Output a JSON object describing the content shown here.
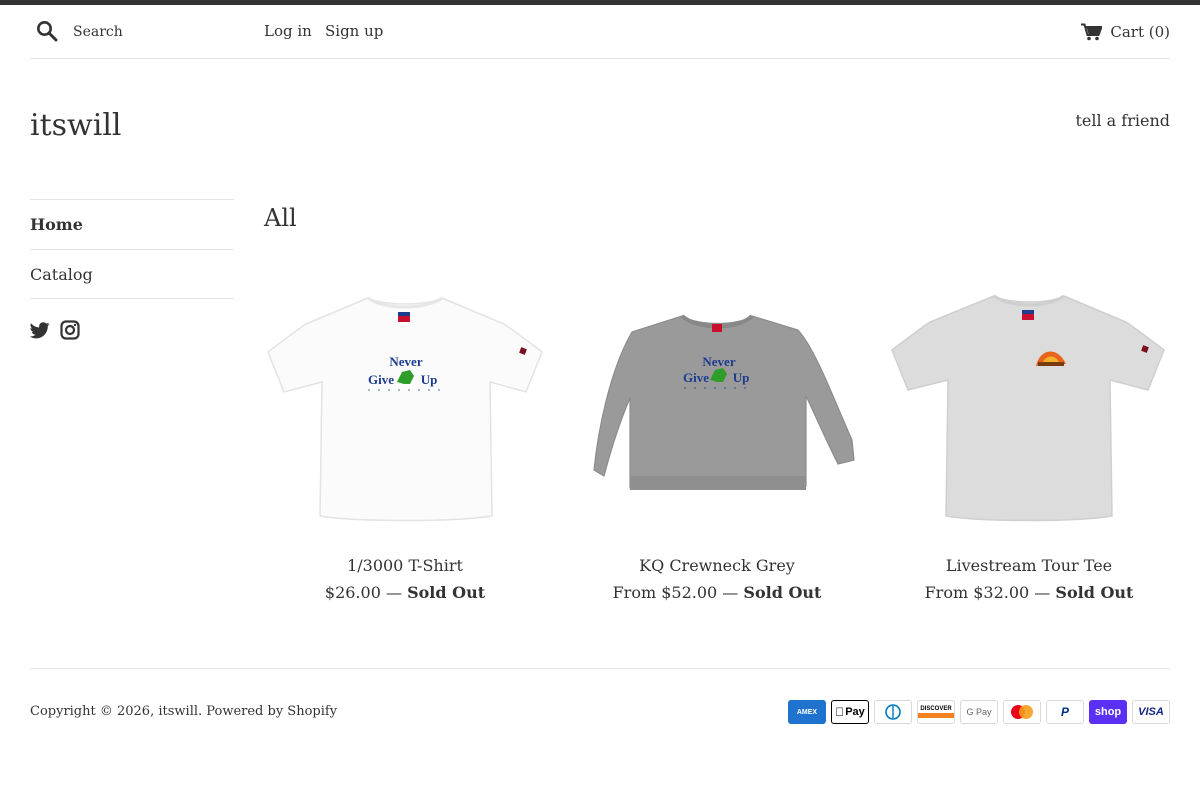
{
  "header": {
    "search_placeholder": "Search",
    "login_label": "Log in",
    "signup_label": "Sign up",
    "cart_label": "Cart (0)"
  },
  "site": {
    "title": "itswill",
    "tell_a_friend": "tell a friend"
  },
  "sidenav": {
    "items": [
      {
        "label": "Home",
        "active": true
      },
      {
        "label": "Catalog",
        "active": false
      }
    ],
    "social": [
      "twitter-icon",
      "instagram-icon"
    ]
  },
  "main": {
    "title": "All",
    "products": [
      {
        "name": "1/3000 T-Shirt",
        "price": "$26.00",
        "separator": "—",
        "status": "Sold Out",
        "image": "white-tshirt-never-give-up"
      },
      {
        "name": "KQ Crewneck Grey",
        "price": "From $52.00",
        "separator": "—",
        "status": "Sold Out",
        "image": "grey-crewneck-never-give-up"
      },
      {
        "name": "Livestream Tour Tee",
        "price": "From $32.00",
        "separator": "—",
        "status": "Sold Out",
        "image": "heather-grey-tshirt-logo"
      }
    ]
  },
  "footer": {
    "copyright_prefix": "Copyright © 2026,",
    "store_link": "itswill",
    "powered_by": "Powered by Shopify",
    "payments": [
      {
        "name": "American Express",
        "label": "AMEX",
        "color": "#1f72cd"
      },
      {
        "name": "Apple Pay",
        "label": "Pay",
        "color": "#000000"
      },
      {
        "name": "Diners Club",
        "label": "D",
        "color": "#0079be"
      },
      {
        "name": "Discover",
        "label": "DISCOVER",
        "color": "#f48120"
      },
      {
        "name": "Google Pay",
        "label": "G Pay",
        "color": "#5f6368"
      },
      {
        "name": "Mastercard",
        "label": "",
        "color": "#eb001b"
      },
      {
        "name": "PayPal",
        "label": "P",
        "color": "#003087"
      },
      {
        "name": "Shop Pay",
        "label": "shop",
        "color": "#5a31f4"
      },
      {
        "name": "Visa",
        "label": "VISA",
        "color": "#142688"
      }
    ]
  }
}
